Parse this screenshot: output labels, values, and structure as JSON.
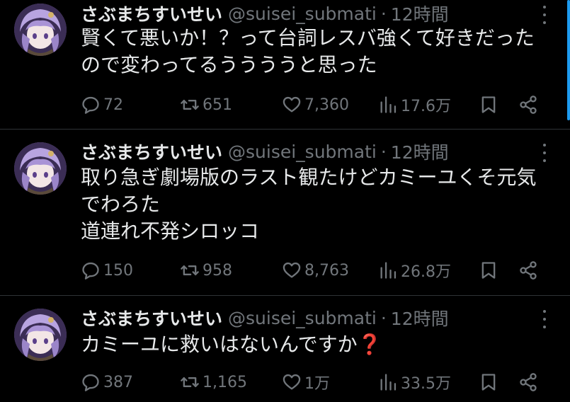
{
  "tweets": [
    {
      "name": "さぶまちすいせい",
      "handle": "@suisei_submati",
      "dot": "·",
      "time": "12時間",
      "lines": [
        "賢くて悪いか！？って台詞レスバ強くて好きだった",
        "ので変わってるううううと思った"
      ],
      "replies": "72",
      "retweets": "651",
      "likes": "7,360",
      "views": "17.6万"
    },
    {
      "name": "さぶまちすいせい",
      "handle": "@suisei_submati",
      "dot": "·",
      "time": "12時間",
      "lines": [
        "取り急ぎ劇場版のラスト観たけどカミーユくそ元気",
        "でわろた",
        "道連れ不発シロッコ"
      ],
      "replies": "150",
      "retweets": "958",
      "likes": "8,763",
      "views": "26.8万"
    },
    {
      "name": "さぶまちすいせい",
      "handle": "@suisei_submati",
      "dot": "·",
      "time": "12時間",
      "lines": [
        "カミーユに救いはないんですか❓"
      ],
      "replies": "387",
      "retweets": "1,165",
      "likes": "1万",
      "views": "33.5万"
    }
  ],
  "icons": {
    "reply": "speech-bubble-icon",
    "retweet": "retweet-arrows-icon",
    "like": "heart-icon",
    "views": "bar-chart-icon",
    "bookmark": "bookmark-icon",
    "share": "share-nodes-icon",
    "more": "vertical-ellipsis-icon"
  },
  "colors": {
    "background": "#000000",
    "text": "#e7e9ea",
    "muted": "#71767b",
    "divider": "#2f3336",
    "accent": "#1d9bf0",
    "emoji_question": "#e0223a"
  }
}
